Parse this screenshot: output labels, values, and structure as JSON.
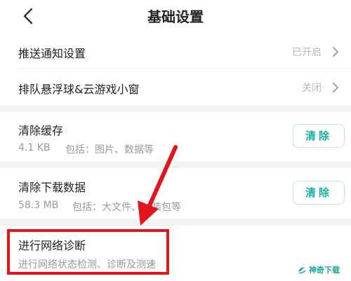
{
  "header": {
    "title": "基础设置"
  },
  "settings": [
    {
      "label": "推送通知设置",
      "value": "已开启"
    },
    {
      "label": "排队悬浮球&云游戏小窗",
      "value": "关闭"
    }
  ],
  "cache": {
    "title": "清除缓存",
    "size": "4.1 KB",
    "detail": "包括：图片、数据等",
    "button": "清除"
  },
  "download": {
    "title": "清除下载数据",
    "size": "58.3 MB",
    "detail": "包括：大文件、",
    "detail_tail": "装包等",
    "button": "清除"
  },
  "network": {
    "title": "进行网络诊断",
    "subtitle": "进行网络状态检测、诊断及测速"
  },
  "watermark": {
    "text": "神奇下载"
  },
  "colors": {
    "accent": "#14b39f",
    "highlight": "#e0161c"
  }
}
